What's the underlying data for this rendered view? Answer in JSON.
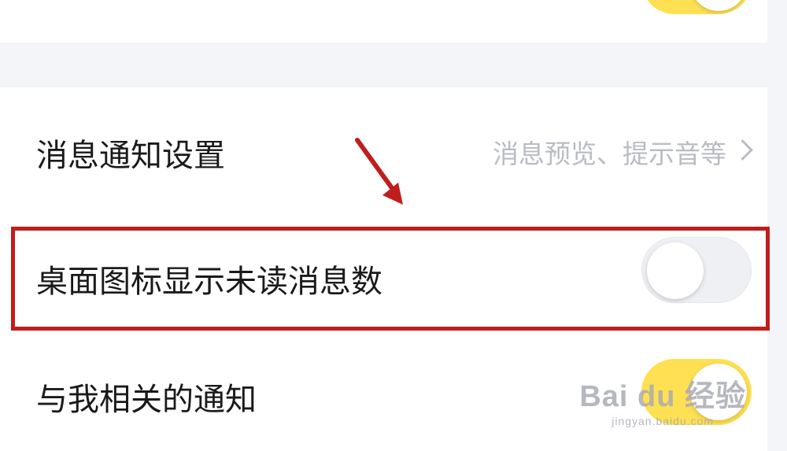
{
  "settings": {
    "rows": [
      {
        "label": "消息通知设置",
        "hint": "消息预览、提示音等"
      },
      {
        "label": "桌面图标显示未读消息数",
        "toggle_on": false
      },
      {
        "label": "与我相关的通知",
        "toggle_on": true
      }
    ]
  },
  "annotation": {
    "highlight_color": "#c01d1d"
  },
  "watermark": {
    "main": "Bai du 经验",
    "sub": "jingyan.baidu.com"
  },
  "colors": {
    "toggle_on": "#ffe052",
    "toggle_off": "#eef0f4",
    "background": "#f4f5f8"
  }
}
